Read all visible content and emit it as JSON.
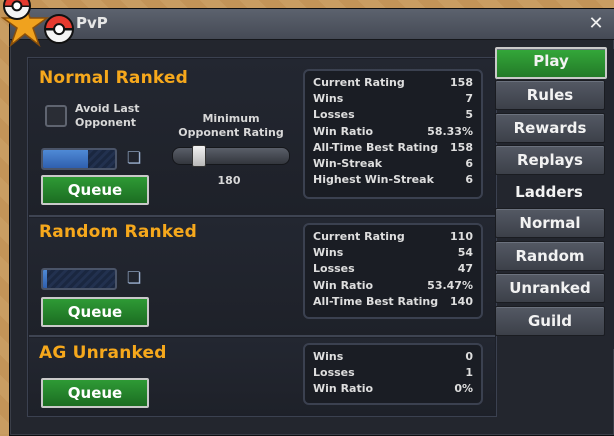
{
  "window": {
    "title": "PvP"
  },
  "normal_ranked": {
    "title": "Normal Ranked",
    "avoid_last_opponent": "Avoid Last Opponent",
    "min_rating_label": "Minimum Opponent Rating",
    "min_rating_value": "180",
    "queue_label": "Queue",
    "progress_fraction": 0.62,
    "slider_fraction": 0.16,
    "stats": [
      {
        "label": "Current Rating",
        "value": "158"
      },
      {
        "label": "Wins",
        "value": "7"
      },
      {
        "label": "Losses",
        "value": "5"
      },
      {
        "label": "Win Ratio",
        "value": "58.33%"
      },
      {
        "label": "All-Time Best Rating",
        "value": "158"
      },
      {
        "label": "Win-Streak",
        "value": "6"
      },
      {
        "label": "Highest Win-Streak",
        "value": "6"
      }
    ]
  },
  "random_ranked": {
    "title": "Random Ranked",
    "queue_label": "Queue",
    "progress_fraction": 0.05,
    "stats": [
      {
        "label": "Current Rating",
        "value": "110"
      },
      {
        "label": "Wins",
        "value": "54"
      },
      {
        "label": "Losses",
        "value": "47"
      },
      {
        "label": "Win Ratio",
        "value": "53.47%"
      },
      {
        "label": "All-Time Best Rating",
        "value": "140"
      }
    ]
  },
  "ag_unranked": {
    "title": "AG Unranked",
    "queue_label": "Queue",
    "stats": [
      {
        "label": "Wins",
        "value": "0"
      },
      {
        "label": "Losses",
        "value": "1"
      },
      {
        "label": "Win Ratio",
        "value": "0%"
      }
    ]
  },
  "menu": {
    "play": "Play",
    "rules": "Rules",
    "rewards": "Rewards",
    "replays": "Replays",
    "ladders_header": "Ladders",
    "normal": "Normal",
    "random": "Random",
    "unranked": "Unranked",
    "guild": "Guild"
  },
  "colors": {
    "section_title": "#f6a81c",
    "queue_green": "#2e9a35",
    "play_green": "#34a83a"
  }
}
